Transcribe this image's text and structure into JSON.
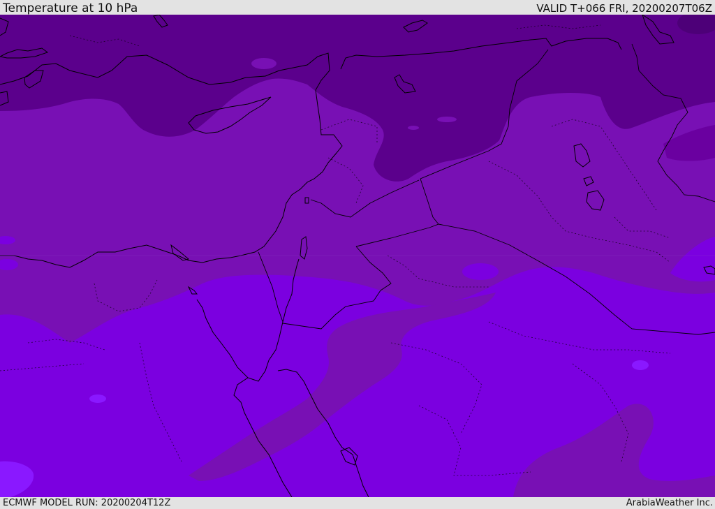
{
  "header": {
    "title": "Temperature at 10 hPa",
    "valid": "VALID T+066 FRI, 20200207T06Z"
  },
  "footer": {
    "model_run": "ECMWF MODEL RUN: 20200204T12Z",
    "credit": "ArabiaWeather Inc."
  },
  "colors": {
    "band_coldest": "#5b008c",
    "band_cold": "#6a00a0",
    "band_mid": "#7810b4",
    "band_warm": "#7b00e0",
    "band_warmest": "#8a18ff",
    "border": "#000000",
    "bar_background": "#e3e3e3"
  }
}
